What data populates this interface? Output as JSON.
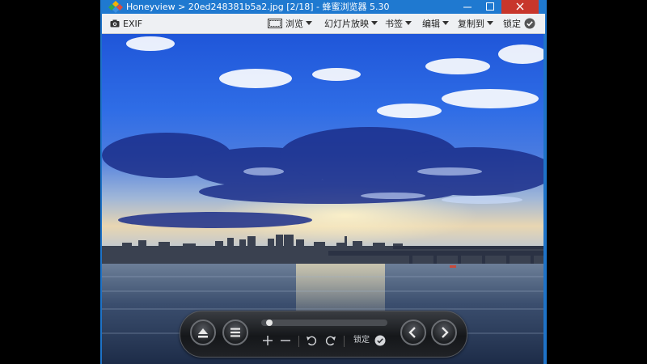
{
  "window": {
    "title": "Honeyview > 20ed248381b5a2.jpg [2/18] - 蜂蜜浏览器 5.30",
    "colors": {
      "titlebar": "#1f79d0",
      "close": "#c8362b",
      "toolbar": "#eef0f3"
    }
  },
  "toolbar": {
    "exif": "EXIF",
    "browse": "浏览",
    "slideshow": "幻灯片放映",
    "bookmark": "书签",
    "edit": "编辑",
    "copy_to": "复制到",
    "lock": "锁定"
  },
  "controls": {
    "lock": "锁定",
    "icons": [
      "eject-icon",
      "menu-icon",
      "plus-icon",
      "minus-icon",
      "rotate-left-icon",
      "rotate-right-icon",
      "check-icon",
      "chevron-left-icon",
      "chevron-right-icon"
    ]
  }
}
